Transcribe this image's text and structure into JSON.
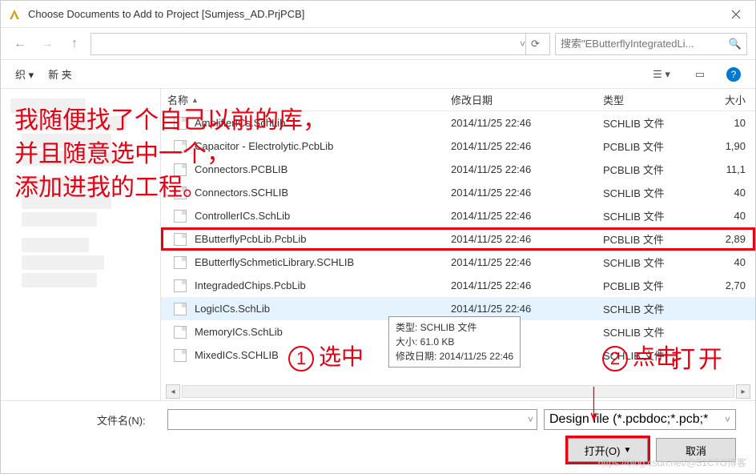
{
  "title": "Choose Documents to Add to Project [Sumjess_AD.PrjPCB]",
  "search_placeholder": "搜索\"EButterflyIntegratedLi...",
  "toolbar": {
    "organize": "织 ▾",
    "new_folder": "新    夹"
  },
  "columns": {
    "name": "名称",
    "date": "修改日期",
    "type": "类型",
    "size": "大小"
  },
  "files": [
    {
      "name": "AmplifierICs.SchLib",
      "date": "2014/11/25 22:46",
      "type": "SCHLIB 文件",
      "size": "10"
    },
    {
      "name": "Capacitor - Electrolytic.PcbLib",
      "date": "2014/11/25 22:46",
      "type": "PCBLIB 文件",
      "size": "1,90"
    },
    {
      "name": "Connectors.PCBLIB",
      "date": "2014/11/25 22:46",
      "type": "PCBLIB 文件",
      "size": "11,1"
    },
    {
      "name": "Connectors.SCHLIB",
      "date": "2014/11/25 22:46",
      "type": "SCHLIB 文件",
      "size": "40"
    },
    {
      "name": "ControllerICs.SchLib",
      "date": "2014/11/25 22:46",
      "type": "SCHLIB 文件",
      "size": "40"
    },
    {
      "name": "EButterflyPcbLib.PcbLib",
      "date": "2014/11/25 22:46",
      "type": "PCBLIB 文件",
      "size": "2,89",
      "highlight": true
    },
    {
      "name": "EButterflySchmeticLibrary.SCHLIB",
      "date": "2014/11/25 22:46",
      "type": "SCHLIB 文件",
      "size": "40"
    },
    {
      "name": "IntegradedChips.PcbLib",
      "date": "2014/11/25 22:46",
      "type": "PCBLIB 文件",
      "size": "2,70"
    },
    {
      "name": "LogicICs.SchLib",
      "date": "2014/11/25 22:46",
      "type": "SCHLIB 文件",
      "size": "",
      "hover": true
    },
    {
      "name": "MemoryICs.SchLib",
      "date": "",
      "type": "SCHLIB 文件",
      "size": ""
    },
    {
      "name": "MixedICs.SCHLIB",
      "date": "",
      "type": "SCHLIB 文件",
      "size": ""
    }
  ],
  "tooltip": {
    "line1": "类型: SCHLIB 文件",
    "line2": "大小: 61.0 KB",
    "line3": "修改日期: 2014/11/25 22:46"
  },
  "footer": {
    "filename_label": "文件名(N):",
    "filter": "Design file (*.pcbdoc;*.pcb;*",
    "open": "打开(O)",
    "cancel": "取消"
  },
  "annotations": {
    "main": "我随便找了个自己以前的库，\n并且随意选中一个，\n添加进我的工程。",
    "step1": "选中",
    "step2": "点击",
    "open_word": "打开"
  },
  "watermark": "https://blog.csdn.net/@51CTO博客"
}
